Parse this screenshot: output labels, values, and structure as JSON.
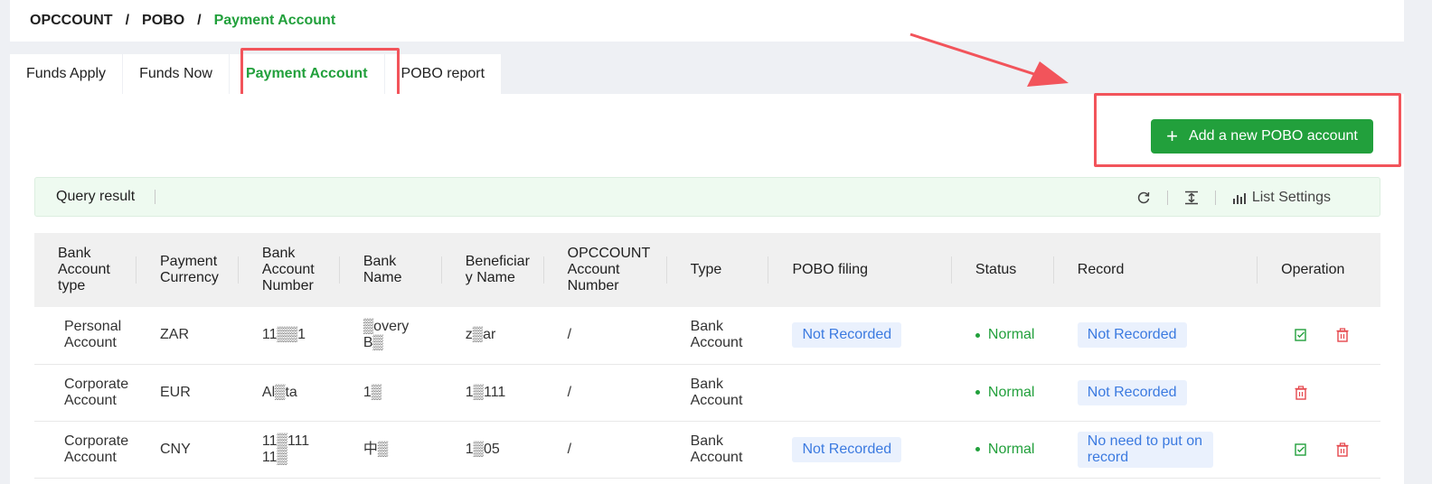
{
  "breadcrumb": {
    "root": "OPCCOUNT",
    "section": "POBO",
    "current": "Payment Account",
    "sep": "/"
  },
  "tabs": [
    {
      "label": "Funds Apply"
    },
    {
      "label": "Funds Now"
    },
    {
      "label": "Payment Account"
    },
    {
      "label": "POBO report"
    }
  ],
  "add_button": {
    "label": "Add a new POBO account"
  },
  "query_bar": {
    "label": "Query result",
    "list_settings": "List Settings"
  },
  "table": {
    "headers": [
      "Bank Account type",
      "Payment Currency",
      "Bank Account Number",
      "Bank Name",
      "Beneficiary Name",
      "OPCCOUNT Account Number",
      "Type",
      "POBO filing",
      "Status",
      "Record",
      "Operation"
    ],
    "rows": [
      {
        "account_type": "Personal Account",
        "currency": "ZAR",
        "account_number": "11▒▒1",
        "bank_name": "▒overy B▒",
        "beneficiary": "z▒ar",
        "opc_number": "/",
        "type": "Bank Account",
        "pobo_filing": "Not Recorded",
        "status": "Normal",
        "record": "Not Recorded",
        "has_edit": true
      },
      {
        "account_type": "Corporate Account",
        "currency": "EUR",
        "account_number": "Al▒ta",
        "bank_name": "1▒",
        "beneficiary": "1▒111",
        "opc_number": "/",
        "type": "Bank Account",
        "pobo_filing": "",
        "status": "Normal",
        "record": "Not Recorded",
        "has_edit": false
      },
      {
        "account_type": "Corporate Account",
        "currency": "CNY",
        "account_number": "11▒111 11▒",
        "bank_name": "中▒",
        "beneficiary": "1▒05",
        "opc_number": "/",
        "type": "Bank Account",
        "pobo_filing": "Not Recorded",
        "status": "Normal",
        "record": "No need to put on record",
        "has_edit": true
      }
    ]
  },
  "colors": {
    "accent": "#22a03c",
    "highlight": "#f2545b",
    "tag_bg": "#eaf1fd",
    "tag_text": "#3b7ae0",
    "delete": "#e5484d"
  },
  "icons": {
    "add": "plus-icon",
    "refresh": "refresh-icon",
    "density": "column-height-icon",
    "settings": "bar-chart-icon",
    "edit": "edit-icon",
    "delete": "delete-icon"
  }
}
